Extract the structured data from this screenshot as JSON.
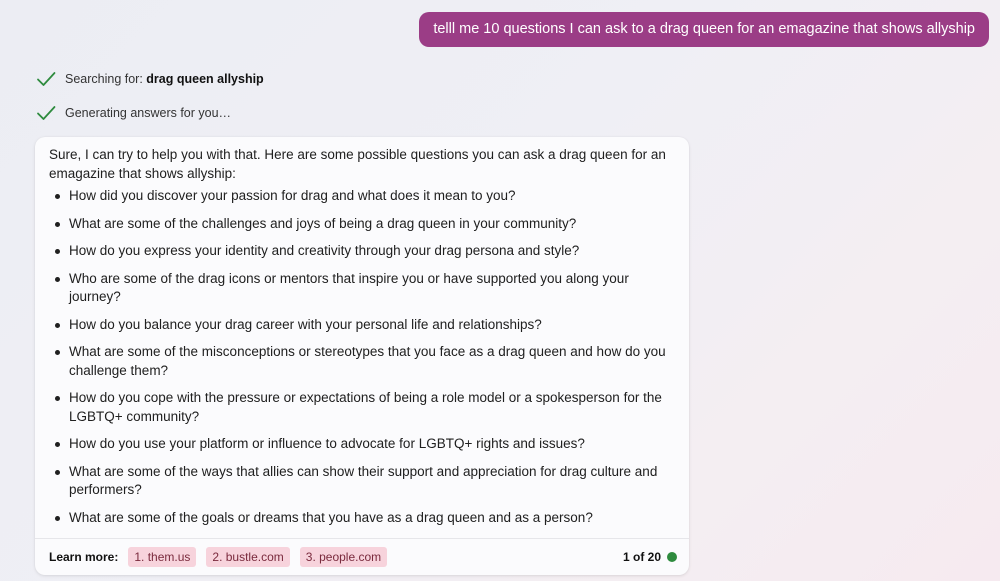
{
  "user_message": "telll me 10 questions I can ask to a drag queen for an emagazine that shows allyship",
  "status": {
    "searching_prefix": "Searching for: ",
    "searching_query": "drag queen allyship",
    "generating": "Generating answers for you…"
  },
  "answer": {
    "intro": "Sure, I can try to help you with that. Here are some possible questions you can ask a drag queen for an emagazine that shows allyship:",
    "questions": [
      "How did you discover your passion for drag and what does it mean to you?",
      "What are some of the challenges and joys of being a drag queen in your community?",
      "How do you express your identity and creativity through your drag persona and style?",
      "Who are some of the drag icons or mentors that inspire you or have supported you along your journey?",
      "How do you balance your drag career with your personal life and relationships?",
      "What are some of the misconceptions or stereotypes that you face as a drag queen and how do you challenge them?",
      "How do you cope with the pressure or expectations of being a role model or a spokesperson for the LGBTQ+ community?",
      "How do you use your platform or influence to advocate for LGBTQ+ rights and issues?",
      "What are some of the ways that allies can show their support and appreciation for drag culture and performers?",
      "What are some of the goals or dreams that you have as a drag queen and as a person?"
    ]
  },
  "learn_more": {
    "label": "Learn more:",
    "sources": [
      "1. them.us",
      "2. bustle.com",
      "3. people.com"
    ],
    "page_count": "1 of 20"
  },
  "colors": {
    "user_bubble": "#9b3d86",
    "check": "#2e8b3e",
    "chip_bg": "#f7d3dc",
    "chip_text": "#7a2a3d",
    "status_dot": "#2e8b3e"
  },
  "icons": {
    "status_check": "check-icon",
    "turn_status": "status-dot-icon"
  }
}
